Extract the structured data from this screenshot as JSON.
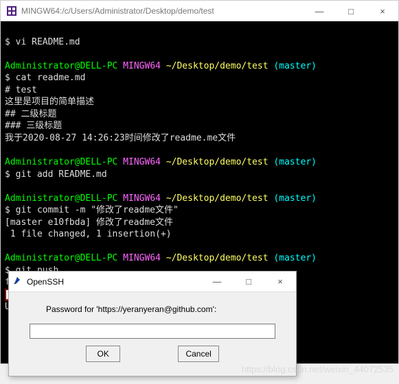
{
  "main_window": {
    "title": "MINGW64:/c/Users/Administrator/Desktop/demo/test",
    "buttons": {
      "minimize": "—",
      "maximize": "□",
      "close": "×"
    }
  },
  "terminal": {
    "prompt_user": "Administrator@DELL-PC",
    "prompt_sys": "MINGW64",
    "prompt_path": "~/Desktop/demo/test",
    "prompt_branch": "(master)",
    "lines": {
      "cmd1": "$ vi README.md",
      "cmd2": "$ cat readme.md",
      "out2a": "# test",
      "out2b": "这里是项目的简单描述",
      "out2c": "## 二级标题",
      "out2d": "### 三级标题",
      "out2e": "我于2020-08-27 14:26:23时间修改了readme.me文件",
      "cmd3": "$ git add README.md",
      "cmd4": "$ git commit -m \"修改了readme文件\"",
      "out4a": "[master e10fbda] 修改了readme文件",
      "out4b": " 1 file changed, 1 insertion(+)",
      "cmd5": "$ git push",
      "out5a": "fatal: HttpRequestException encountered.",
      "out5b_redacted": "▇▇▇▇▇▇▇▇▇▇▇",
      "out5c": "Username for 'https://github.com': yeranyeran"
    }
  },
  "dialog": {
    "title": "OpenSSH",
    "label": "Password for 'https://yeranyeran@github.com':",
    "input_value": "",
    "ok": "OK",
    "cancel": "Cancel",
    "buttons": {
      "minimize": "—",
      "maximize": "□",
      "close": "×"
    }
  },
  "watermark": "https://blog.csdn.net/weixin_44072535"
}
